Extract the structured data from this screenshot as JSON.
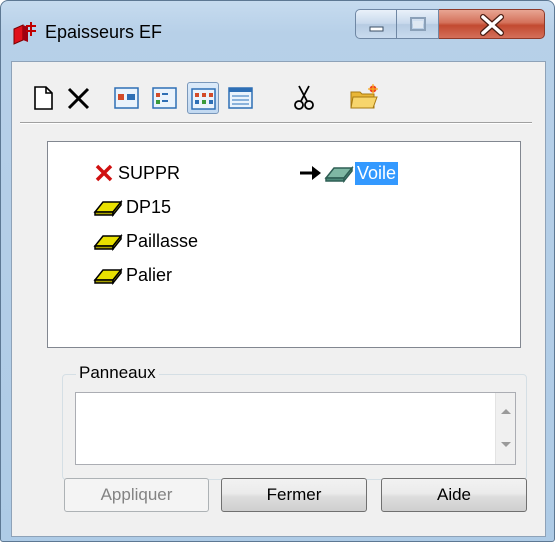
{
  "window": {
    "title": "Epaisseurs EF",
    "controls": {
      "minimize": "minimize",
      "maximize": "maximize",
      "close": "close"
    }
  },
  "toolbar": {
    "buttons": [
      {
        "icon": "new-document-icon"
      },
      {
        "icon": "delete-x-icon"
      },
      {
        "icon": "large-icons-view-icon"
      },
      {
        "icon": "small-icons-view-icon"
      },
      {
        "icon": "list-view-icon",
        "pressed": true
      },
      {
        "icon": "details-view-icon"
      },
      {
        "icon": "cut-scissors-icon"
      },
      {
        "icon": "open-folder-icon"
      }
    ]
  },
  "list": {
    "items": [
      {
        "label": "SUPPR",
        "icon": "red-x-icon"
      },
      {
        "label": "DP15",
        "icon": "yellow-slab-icon"
      },
      {
        "label": "Paillasse",
        "icon": "yellow-slab-icon"
      },
      {
        "label": "Palier",
        "icon": "yellow-slab-icon"
      },
      {
        "label": "Voile",
        "icon": "teal-slab-icon",
        "selected": true,
        "current_marker": "arrow-right-icon"
      }
    ]
  },
  "panneaux": {
    "label": "Panneaux",
    "value": ""
  },
  "buttons": {
    "apply": "Appliquer",
    "close": "Fermer",
    "help": "Aide"
  },
  "colors": {
    "selection": "#3399ff",
    "close_button": "#c24a30",
    "slab_yellow": "#e8e000",
    "slab_teal": "#7fb8a4",
    "delete_red": "#d01010"
  }
}
